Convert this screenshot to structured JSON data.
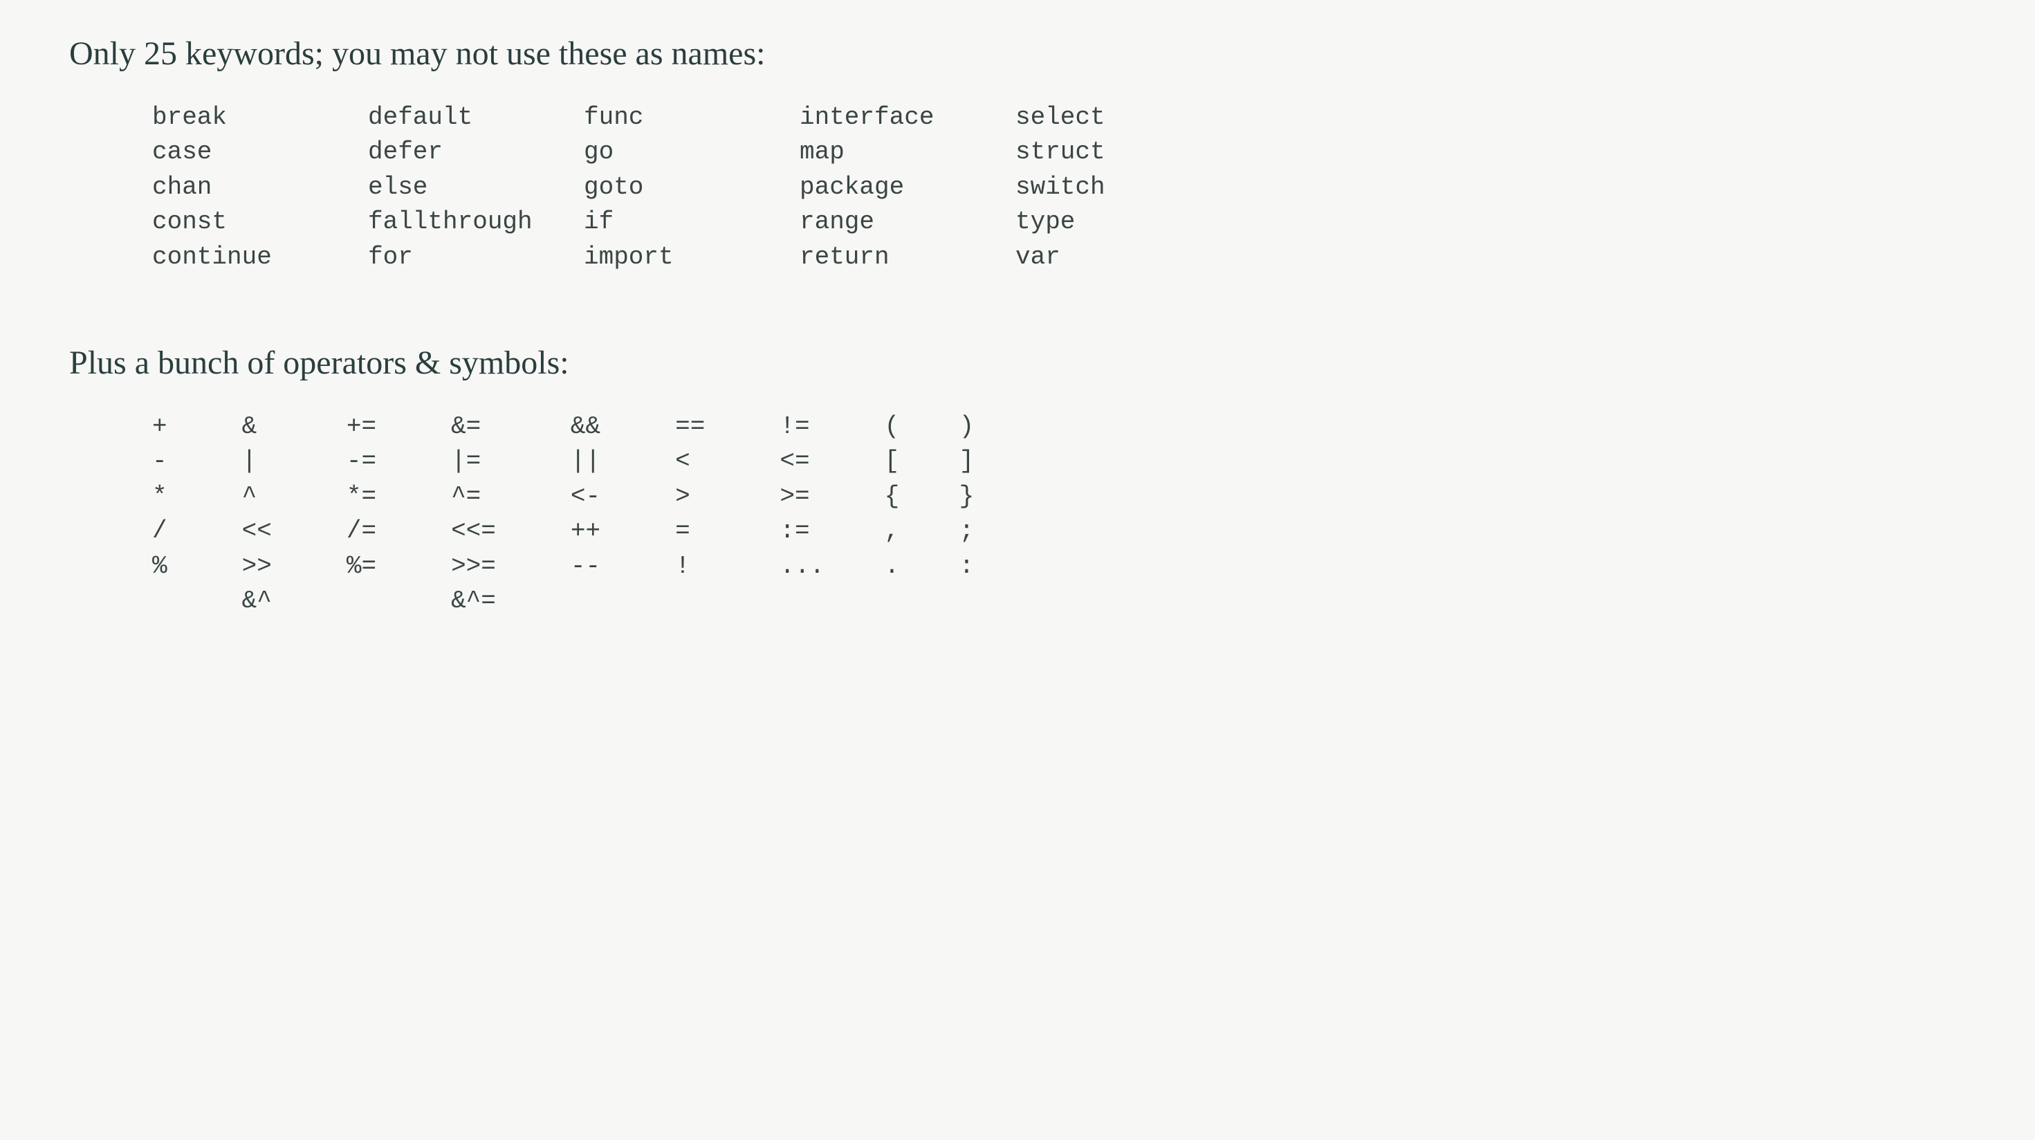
{
  "heading1": "Only 25 keywords; you may not use these as names:",
  "keywords": {
    "col1": "break\ncase\nchan\nconst\ncontinue",
    "col2": "default\ndefer\nelse\nfallthrough\nfor",
    "col3": "func\ngo\ngoto\nif\nimport",
    "col4": "interface\nmap\npackage\nrange\nreturn",
    "col5": "select\nstruct\nswitch\ntype\nvar"
  },
  "heading2": "Plus a bunch of operators & symbols:",
  "operators": "+     &      +=     &=      &&     ==     !=     (    )\n-     |      -=     |=      ||     <      <=     [    ]\n*     ^      *=     ^=      <-     >      >=     {    }\n/     <<     /=     <<=     ++     =      :=     ,    ;\n%     >>     %=     >>=     --     !      ...    .    :\n      &^            &^="
}
